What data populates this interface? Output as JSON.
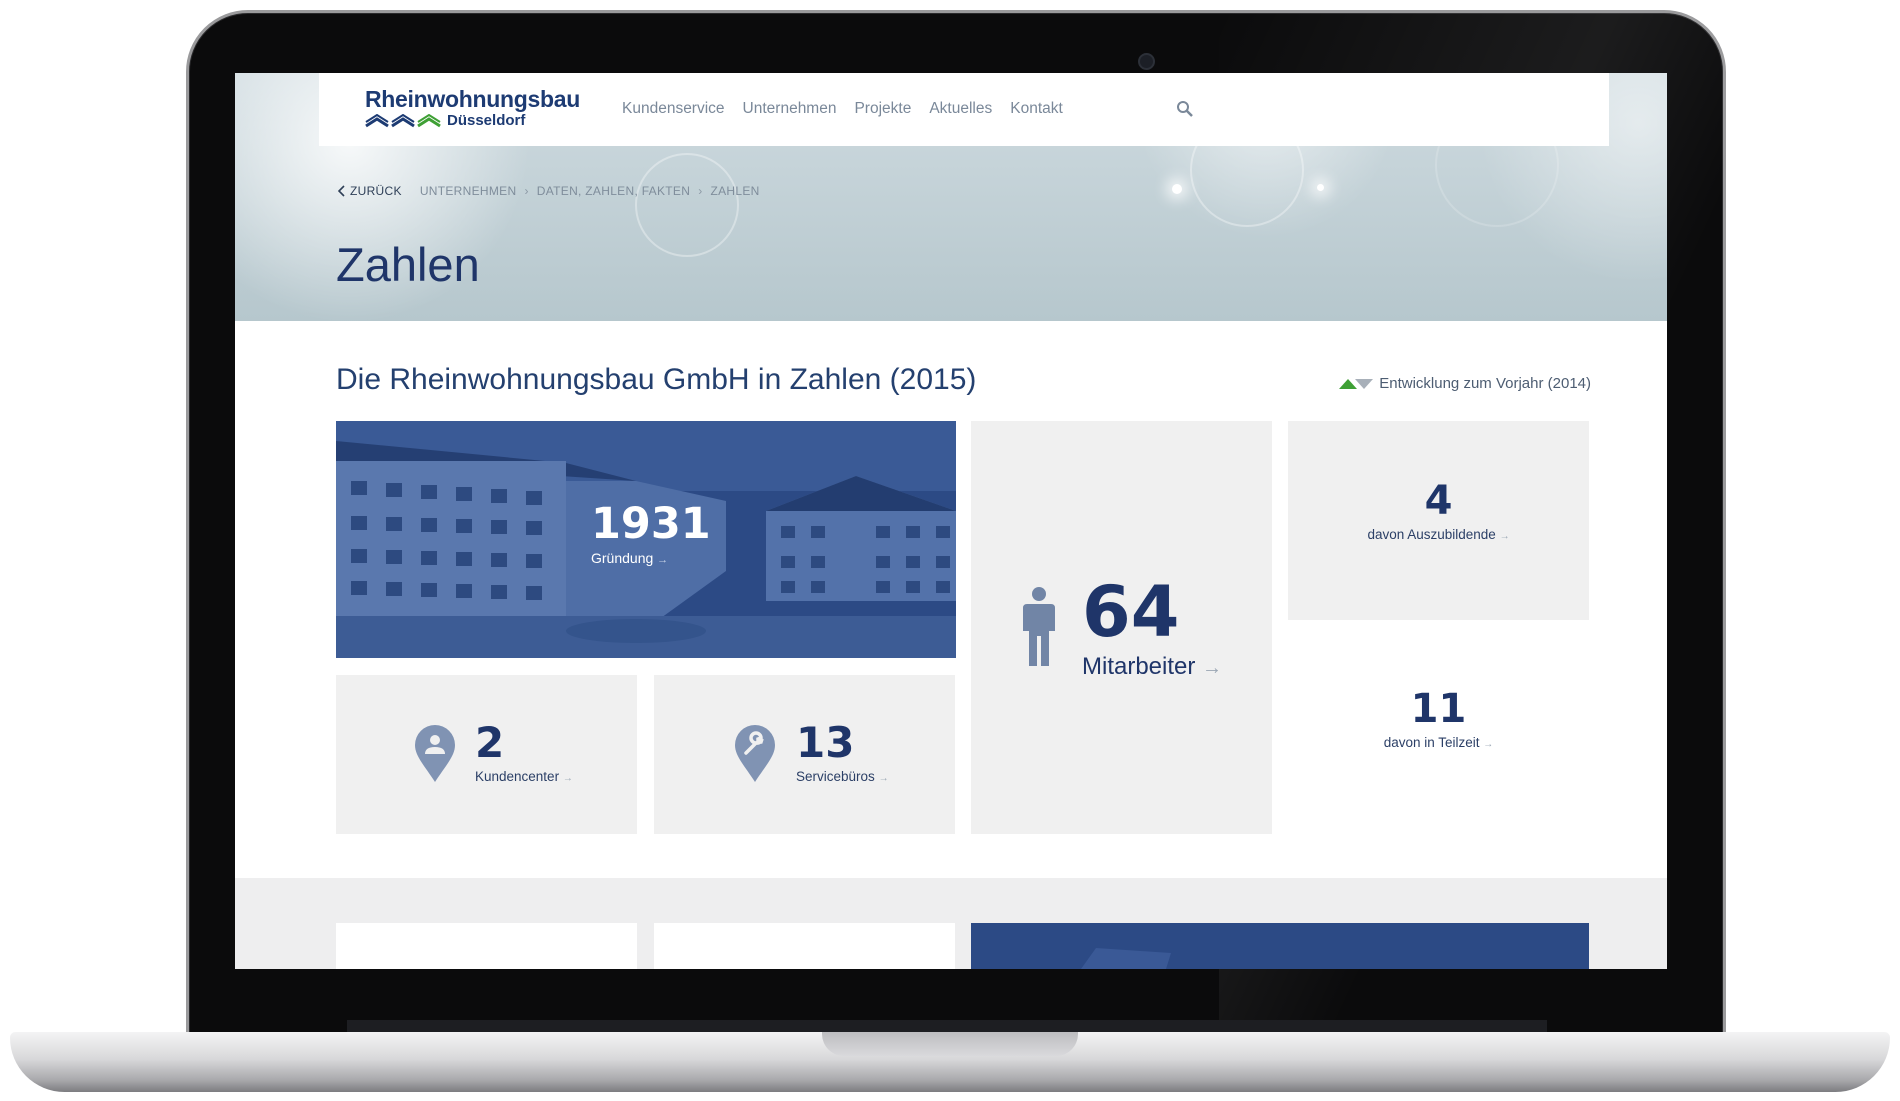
{
  "nav": {
    "logo_line1": "Rheinwohnungsbau",
    "logo_line2": "Düsseldorf",
    "menu": [
      "Kundenservice",
      "Unternehmen",
      "Projekte",
      "Aktuelles",
      "Kontakt"
    ],
    "search_icon": "search-icon"
  },
  "breadcrumb": {
    "back": "ZURÜCK",
    "items": [
      "UNTERNEHMEN",
      "DATEN, ZAHLEN, FAKTEN",
      "ZAHLEN"
    ]
  },
  "page_title": "Zahlen",
  "section": {
    "title": "Die Rheinwohnungsbau GmbH in Zahlen (2015)",
    "legend": "Entwicklung zum Vorjahr (2014)"
  },
  "stats": {
    "founding": {
      "value": "1931",
      "label": "Gründung"
    },
    "employees": {
      "value": "64",
      "label": "Mitarbeiter"
    },
    "apprentices": {
      "value": "4",
      "label": "davon Auszubildende"
    },
    "parttime": {
      "value": "11",
      "label": "davon in Teilzeit"
    },
    "customer_centers": {
      "value": "2",
      "label": "Kundencenter"
    },
    "service_offices": {
      "value": "13",
      "label": "Servicebüros"
    }
  },
  "colors": {
    "brand": "#1f3569",
    "accent_green": "#3fa035",
    "tile_bg": "#f0f0f0",
    "photo_overlay": "#2b4a86"
  },
  "icons": [
    "person-icon",
    "location-pin-person-icon",
    "location-pin-wrench-icon",
    "trend-up-icon",
    "trend-down-icon",
    "chevron-left-icon"
  ]
}
